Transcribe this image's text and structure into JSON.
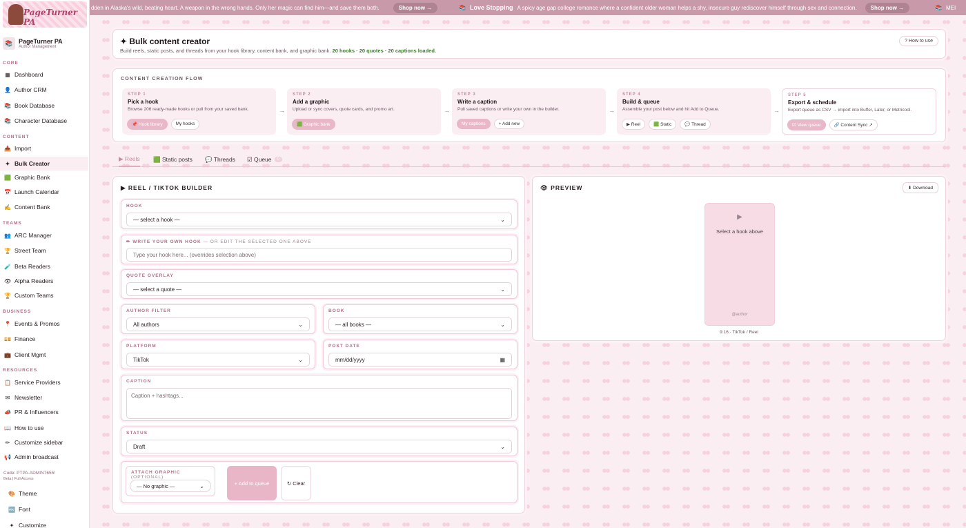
{
  "ticker": {
    "ad1_text": "dden in Alaska's wild, beating heart. A weapon in the wrong hands. Only her magic can find him—and save them both.",
    "ad1_cta": "Shop now →",
    "ad2_title": "Love Stopping",
    "ad2_text": "A spicy age gap college romance where a confident older woman helps a shy, insecure guy rediscover himself through sex and connection.",
    "ad2_cta": "Shop now →",
    "ad3_text": "MEI"
  },
  "sidebar": {
    "logo_text": "PageTurner PA",
    "brand_name": "PageTurner PA",
    "brand_sub": "Author Management",
    "sections": {
      "core": "CORE",
      "content": "CONTENT",
      "teams": "TEAMS",
      "business": "BUSINESS",
      "resources": "RESOURCES"
    },
    "items": {
      "dashboard": "Dashboard",
      "author_crm": "Author CRM",
      "book_db": "Book Database",
      "char_db": "Character Database",
      "import": "Import",
      "bulk_creator": "Bulk Creator",
      "graphic_bank": "Graphic Bank",
      "launch_calendar": "Launch Calendar",
      "content_bank": "Content Bank",
      "arc_manager": "ARC Manager",
      "street_team": "Street Team",
      "beta_readers": "Beta Readers",
      "alpha_readers": "Alpha Readers",
      "custom_teams": "Custom Teams",
      "events": "Events & Promos",
      "finance": "Finance",
      "client_mgmt": "Client Mgmt",
      "service_providers": "Service Providers",
      "newsletter": "Newsletter",
      "pr": "PR & Influencers",
      "how_to": "How to use",
      "customize_sidebar": "Customize sidebar",
      "admin_broadcast": "Admin broadcast",
      "theme": "Theme",
      "font": "Font",
      "customize": "Customize"
    },
    "code_line": "Code: PTPA-ADMIN7655!",
    "access_line": "Beta | Full Access"
  },
  "header": {
    "title": "✦ Bulk content creator",
    "desc": "Build reels, static posts, and threads from your hook library, content bank, and graphic bank.",
    "counts": "20 hooks · 20 quotes · 20 captions loaded.",
    "how_to": "? How to use"
  },
  "flow": {
    "title": "CONTENT CREATION FLOW",
    "steps": [
      {
        "num": "STEP 1",
        "title": "Pick a hook",
        "desc": "Browse 206 ready-made hooks or pull from your saved bank.",
        "btn1": "📌 Hook library",
        "btn2": "My hooks"
      },
      {
        "num": "STEP 2",
        "title": "Add a graphic",
        "desc": "Upload or sync covers, quote cards, and promo art.",
        "btn1": "🟩 Graphic bank"
      },
      {
        "num": "STEP 3",
        "title": "Write a caption",
        "desc": "Pull saved captions or write your own in the builder.",
        "btn1": "My captions",
        "btn2": "+ Add new"
      },
      {
        "num": "STEP 4",
        "title": "Build & queue",
        "desc": "Assemble your post below and hit Add to Queue.",
        "btn1": "▶ Reel",
        "btn2": "🟩 Static",
        "btn3": "💬 Thread"
      },
      {
        "num": "STEP 5",
        "title": "Export & schedule",
        "desc": "Export queue as CSV → import into Buffer, Later, or Metricool.",
        "btn1": "☑ View queue",
        "btn2": "🔗 Content Sync ↗"
      }
    ]
  },
  "tabs": {
    "reels": "▶ Reels",
    "static": "🟩 Static posts",
    "threads": "💬 Threads",
    "queue": "☑ Queue",
    "queue_count": "0"
  },
  "builder": {
    "title": "▶  REEL / TIKTOK BUILDER",
    "hook_label": "HOOK",
    "hook_value": "— select a hook —",
    "own_hook_label": "✏ WRITE YOUR OWN HOOK",
    "own_hook_suffix": "— OR EDIT THE SELECTED ONE ABOVE",
    "own_hook_placeholder": "Type your hook here... (overrides selection above)",
    "quote_label": "QUOTE OVERLAY",
    "quote_value": "— select a quote —",
    "author_label": "AUTHOR FILTER",
    "author_value": "All authors",
    "book_label": "BOOK",
    "book_value": "— all books —",
    "platform_label": "PLATFORM",
    "platform_value": "TikTok",
    "date_label": "POST DATE",
    "date_value": "mm/dd/yyyy",
    "caption_label": "CAPTION",
    "caption_placeholder": "Caption + hashtags...",
    "status_label": "STATUS",
    "status_value": "Draft",
    "attach_label": "ATTACH GRAPHIC",
    "attach_optional": "(OPTIONAL)",
    "attach_value": "— No graphic —",
    "add_btn": "+ Add to queue",
    "clear_btn": "↻ Clear"
  },
  "preview": {
    "title": "👁  PREVIEW",
    "download": "⬇ Download",
    "play": "▶",
    "msg": "Select a hook above",
    "author": "@author",
    "ratio": "9:16 · TikTok / Reel"
  }
}
